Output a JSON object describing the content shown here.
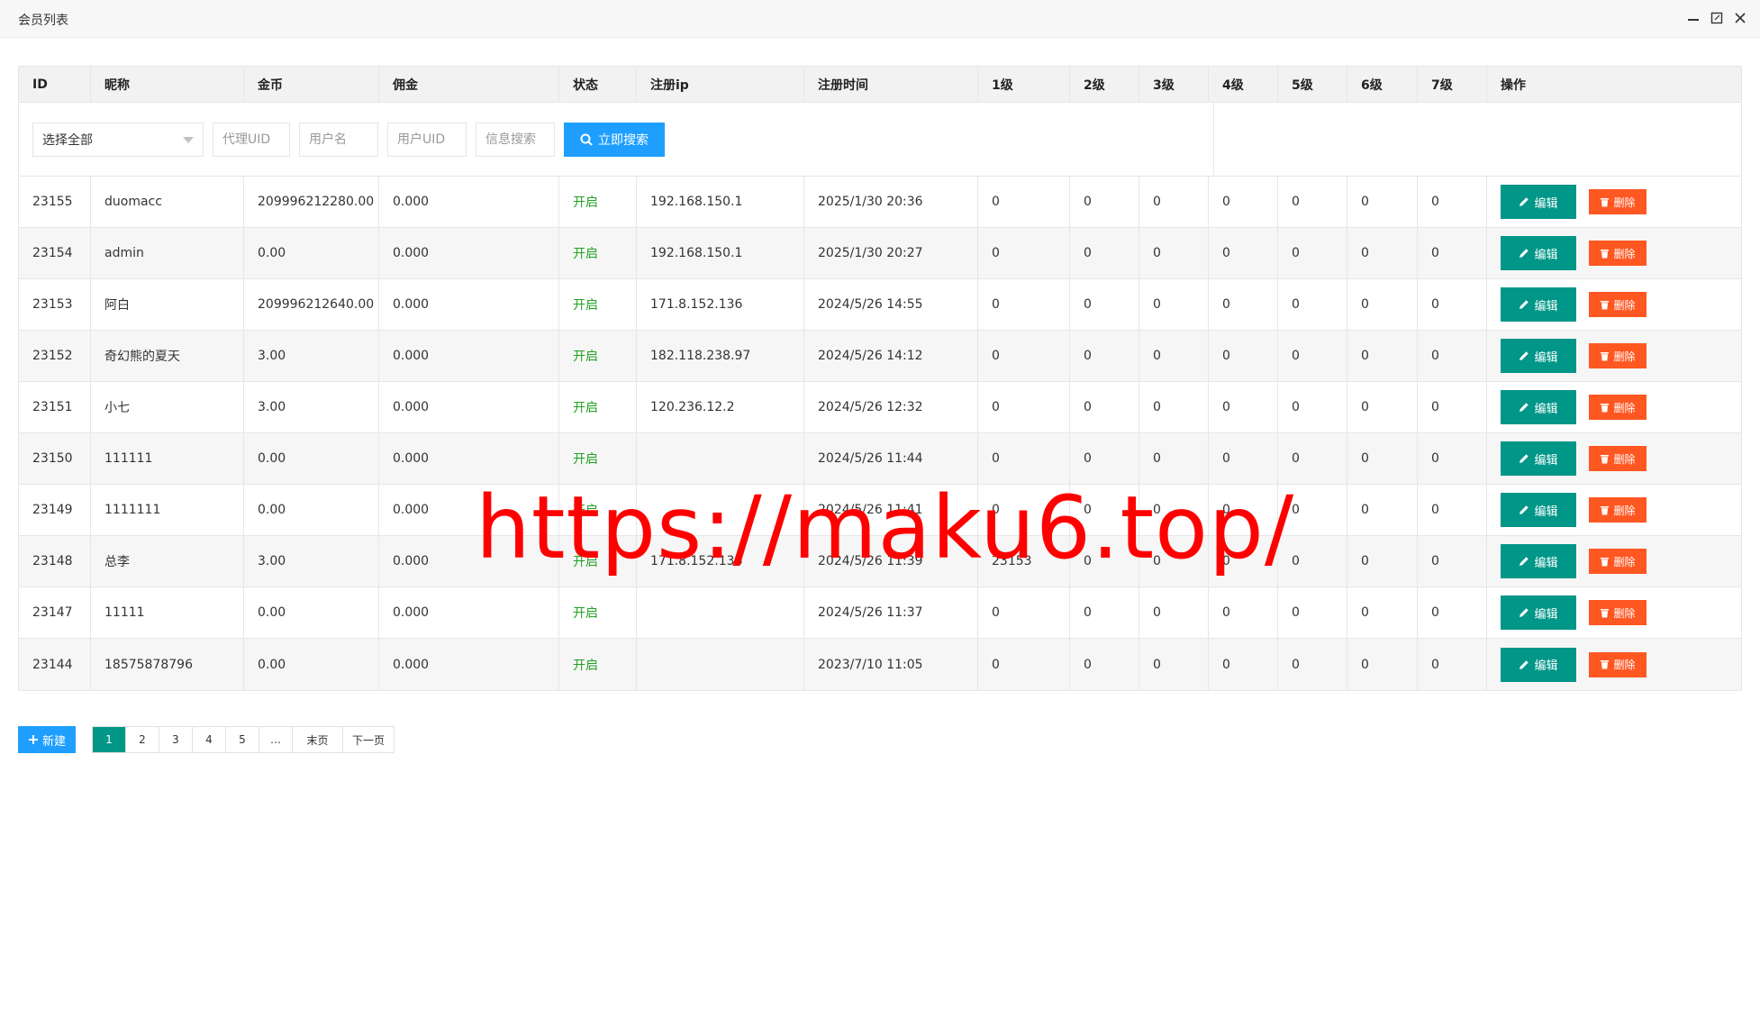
{
  "window": {
    "title": "会员列表",
    "controls": [
      "minimize-icon",
      "maximize-icon",
      "close-icon"
    ]
  },
  "table": {
    "headers": [
      "ID",
      "昵称",
      "金币",
      "佣金",
      "状态",
      "注册ip",
      "注册时间",
      "1级",
      "2级",
      "3级",
      "4级",
      "5级",
      "6级",
      "7级",
      "操作"
    ],
    "rows": [
      [
        "23155",
        "duomacc",
        "209996212280.00",
        "0.000",
        "开启",
        "192.168.150.1",
        "2025/1/30 20:36",
        "0",
        "0",
        "0",
        "0",
        "0",
        "0",
        "0"
      ],
      [
        "23154",
        "admin",
        "0.00",
        "0.000",
        "开启",
        "192.168.150.1",
        "2025/1/30 20:27",
        "0",
        "0",
        "0",
        "0",
        "0",
        "0",
        "0"
      ],
      [
        "23153",
        "阿白",
        "209996212640.00",
        "0.000",
        "开启",
        "171.8.152.136",
        "2024/5/26 14:55",
        "0",
        "0",
        "0",
        "0",
        "0",
        "0",
        "0"
      ],
      [
        "23152",
        "奇幻熊的夏天",
        "3.00",
        "0.000",
        "开启",
        "182.118.238.97",
        "2024/5/26 14:12",
        "0",
        "0",
        "0",
        "0",
        "0",
        "0",
        "0"
      ],
      [
        "23151",
        "小七",
        "3.00",
        "0.000",
        "开启",
        "120.236.12.2",
        "2024/5/26 12:32",
        "0",
        "0",
        "0",
        "0",
        "0",
        "0",
        "0"
      ],
      [
        "23150",
        "111111",
        "0.00",
        "0.000",
        "开启",
        "",
        "2024/5/26 11:44",
        "0",
        "0",
        "0",
        "0",
        "0",
        "0",
        "0"
      ],
      [
        "23149",
        "1111111",
        "0.00",
        "0.000",
        "开启",
        "",
        "2024/5/26 11:41",
        "0",
        "0",
        "0",
        "0",
        "0",
        "0",
        "0"
      ],
      [
        "23148",
        "总李",
        "3.00",
        "0.000",
        "开启",
        "171.8.152.136",
        "2024/5/26 11:39",
        "23153",
        "0",
        "0",
        "0",
        "0",
        "0",
        "0"
      ],
      [
        "23147",
        "11111",
        "0.00",
        "0.000",
        "开启",
        "",
        "2024/5/26 11:37",
        "0",
        "0",
        "0",
        "0",
        "0",
        "0",
        "0"
      ],
      [
        "23144",
        "18575878796",
        "0.00",
        "0.000",
        "开启",
        "",
        "2023/7/10 11:05",
        "0",
        "0",
        "0",
        "0",
        "0",
        "0",
        "0"
      ]
    ],
    "edit_label": "编辑",
    "delete_label": "删除"
  },
  "search": {
    "select_value": "选择全部",
    "agent_uid_placeholder": "代理UID",
    "username_placeholder": "用户名",
    "user_uid_placeholder": "用户UID",
    "info_placeholder": "信息搜索",
    "search_label": "立即搜索"
  },
  "footer": {
    "new_label": "新建",
    "pages": [
      "1",
      "2",
      "3",
      "4",
      "5",
      "…",
      "末页",
      "下一页"
    ],
    "active_page": "1"
  },
  "watermark": "https://maku6.top/",
  "colors": {
    "primary": "#009688",
    "blue": "#1e9fff",
    "danger": "#ff5722",
    "status_on": "#22a022",
    "watermark": "#ff0000"
  }
}
